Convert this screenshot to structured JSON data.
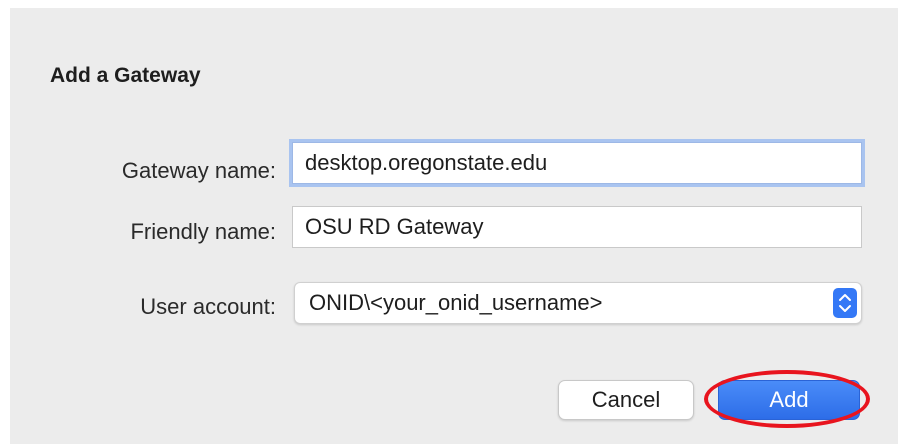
{
  "dialog": {
    "title": "Add a Gateway",
    "fields": {
      "gateway_name": {
        "label": "Gateway name:",
        "value": "desktop.oregonstate.edu"
      },
      "friendly_name": {
        "label": "Friendly name:",
        "value": "OSU RD Gateway"
      },
      "user_account": {
        "label": "User account:",
        "value": "ONID\\<your_onid_username>"
      }
    },
    "buttons": {
      "cancel": "Cancel",
      "add": "Add"
    }
  },
  "colors": {
    "accent": "#3478f6",
    "focus_ring": "#a9c4f0",
    "annotation_ring": "#e8141e",
    "dialog_bg": "#ececec"
  },
  "icons": {
    "stepper": "chevron-up-down-icon"
  }
}
